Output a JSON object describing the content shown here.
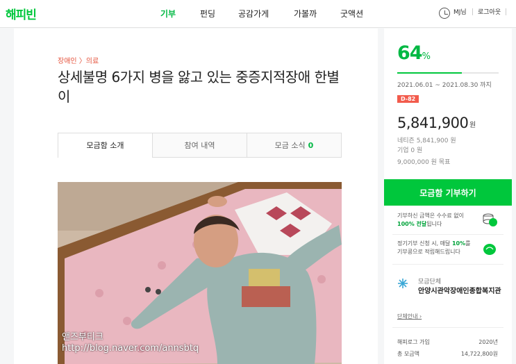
{
  "header": {
    "logo": "해피빈",
    "nav": [
      "기부",
      "펀딩",
      "공감가게",
      "가볼까",
      "굿액션"
    ],
    "user": "MJ님",
    "logout": "로그아웃",
    "clock_icon": "clock-icon"
  },
  "campaign": {
    "category": "장애인 〉의료",
    "title": "상세불명 6가지 병을 앓고 있는 중증지적장애 한별이",
    "tabs": {
      "intro": "모금함 소개",
      "participants": "참여 내역",
      "news": "모금 소식",
      "news_count": "0"
    },
    "photo_watermark": {
      "line1": "앤즈부티크",
      "line2": "http://blog.naver.com/annsbtq"
    }
  },
  "sidebar": {
    "percent": "64",
    "percent_unit": "%",
    "progress_fraction": 0.64,
    "period": "2021.06.01 ~ 2021.08.30 까지",
    "dday": "D-82",
    "amount": "5,841,900",
    "amount_unit": "원",
    "netizen": "네티즌 5,841,900 원",
    "company": "기업 0 원",
    "goal": "9,000,000 원 목표",
    "donate_button": "모금함 기부하기",
    "notice1_a": "기부하신 금액은 수수료 없이",
    "notice1_b_strong": "100% 전달",
    "notice1_b_rest": "됩니다",
    "notice2_a_pre": "정기기부 신청 시, 매달 ",
    "notice2_a_strong": "10%",
    "notice2_a_post": "를",
    "notice2_b": "기부콩으로 적립해드립니다",
    "org_label": "모금단체",
    "org_name": "안양시관악장애인종합복지관",
    "org_link": "단체안내 ›",
    "stats": [
      {
        "label": "해피로그 가입",
        "value": "2020년"
      },
      {
        "label": "총 모금액",
        "value": "14,722,800원"
      }
    ],
    "colors": {
      "accent": "#00c73c",
      "dday": "#f25b4c",
      "category": "#e5553f"
    }
  }
}
